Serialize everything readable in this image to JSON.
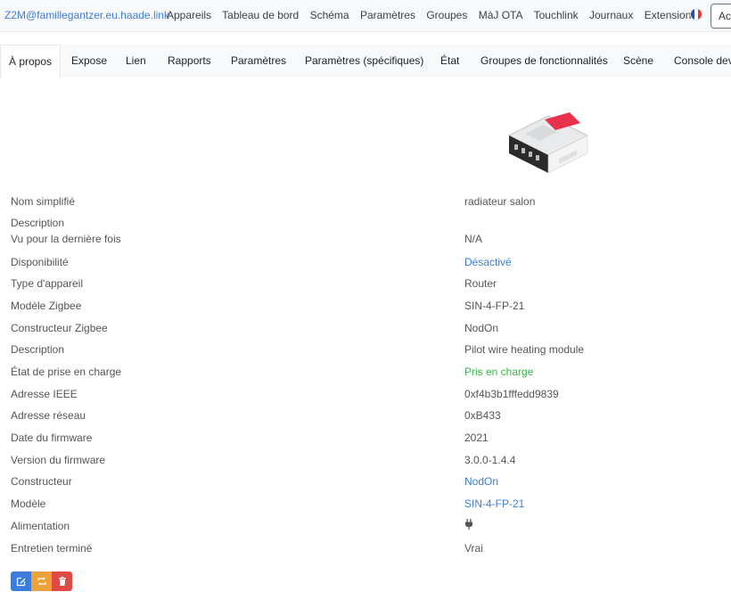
{
  "navbar": {
    "brand": "Z2M@famillegantzer.eu.haade.link",
    "links": [
      "Appareils",
      "Tableau de bord",
      "Schéma",
      "Paramètres",
      "Groupes",
      "MàJ OTA",
      "Touchlink",
      "Journaux",
      "Extensions"
    ],
    "language_flag": "french-flag-icon",
    "account_button_label": "Ac"
  },
  "tabs": [
    "À propos",
    "Expose",
    "Lien",
    "Rapports",
    "Paramètres",
    "Paramètres (spécifiques)",
    "État",
    "Groupes de fonctionnalités",
    "Scène",
    "Console dev"
  ],
  "device": {
    "rows": [
      {
        "label": "Nom simplifié",
        "value": "radiateur salon"
      },
      {
        "label": "Description",
        "value": ""
      },
      {
        "label": "Vu pour la dernière fois",
        "value": "N/A"
      },
      {
        "label": "Disponibilité",
        "value": "Désactivé"
      },
      {
        "label": "Type d'appareil",
        "value": "Router"
      },
      {
        "label": "Modèle Zigbee",
        "value": "SIN-4-FP-21"
      },
      {
        "label": "Constructeur Zigbee",
        "value": "NodOn"
      },
      {
        "label": "Description",
        "value": "Pilot wire heating module"
      },
      {
        "label": "État de prise en charge",
        "value": "Pris en charge"
      },
      {
        "label": "Adresse IEEE",
        "value": "0xf4b3b1fffedd9839"
      },
      {
        "label": "Adresse réseau",
        "value": "0xB433"
      },
      {
        "label": "Date du firmware",
        "value": "2021"
      },
      {
        "label": "Version du firmware",
        "value": "3.0.0-1.4.4"
      },
      {
        "label": "Constructeur",
        "value": "NodOn"
      },
      {
        "label": "Modèle",
        "value": "SIN-4-FP-21"
      },
      {
        "label": "Alimentation",
        "value": ""
      },
      {
        "label": "Entretien terminé",
        "value": "Vrai"
      }
    ],
    "power_icon": "plug-icon"
  },
  "colors": {
    "link": "#3b7dd8",
    "success": "#3fb24f",
    "edit": "#3b7dd8",
    "rename": "#f0a23a",
    "delete": "#e04a44"
  }
}
